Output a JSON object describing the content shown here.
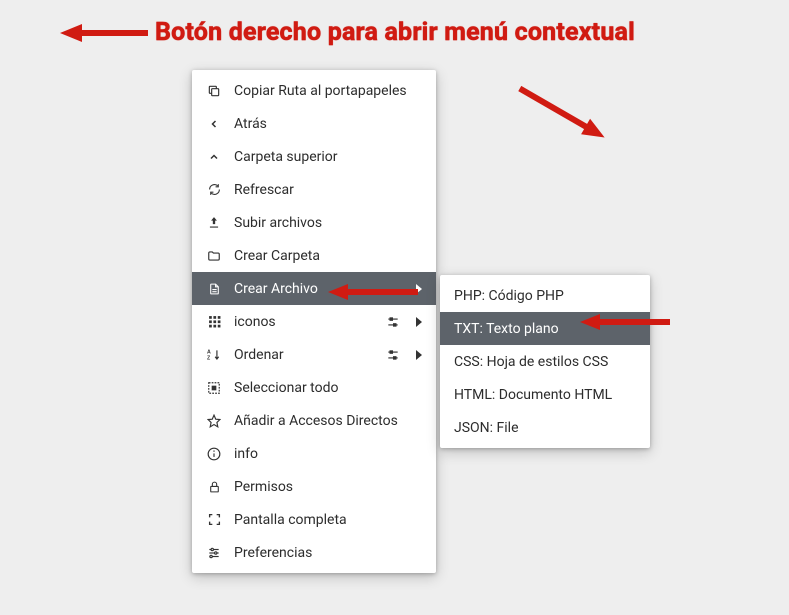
{
  "header": {
    "title": "Botón derecho para abrir menú contextual"
  },
  "menu": {
    "items": [
      {
        "label": "Copiar Ruta al portapapeles",
        "icon": "copy-icon"
      },
      {
        "label": "Atrás",
        "icon": "chevron-left-icon"
      },
      {
        "label": "Carpeta superior",
        "icon": "chevron-up-icon"
      },
      {
        "label": "Refrescar",
        "icon": "refresh-icon"
      },
      {
        "label": "Subir archivos",
        "icon": "upload-icon"
      },
      {
        "label": "Crear Carpeta",
        "icon": "folder-icon"
      },
      {
        "label": "Crear Archivo",
        "icon": "file-icon",
        "submenu": true,
        "highlight": true
      },
      {
        "label": "iconos",
        "icon": "grid-icon",
        "submenu": true,
        "tool": "adjust-icon"
      },
      {
        "label": "Ordenar",
        "icon": "sort-icon",
        "submenu": true,
        "tool": "adjust-icon"
      },
      {
        "label": "Seleccionar todo",
        "icon": "select-all-icon"
      },
      {
        "label": "Añadir a Accesos Directos",
        "icon": "star-icon"
      },
      {
        "label": "info",
        "icon": "info-icon"
      },
      {
        "label": "Permisos",
        "icon": "lock-icon"
      },
      {
        "label": "Pantalla completa",
        "icon": "fullscreen-icon"
      },
      {
        "label": "Preferencias",
        "icon": "sliders-icon"
      }
    ]
  },
  "submenu": {
    "items": [
      {
        "label": "PHP: Código PHP"
      },
      {
        "label": "TXT: Texto plano",
        "highlight": true
      },
      {
        "label": "CSS: Hoja de estilos CSS"
      },
      {
        "label": "HTML: Documento HTML"
      },
      {
        "label": "JSON: File"
      }
    ]
  },
  "colors": {
    "accent": "#d01b12",
    "menu_highlight": "#5d636a"
  }
}
